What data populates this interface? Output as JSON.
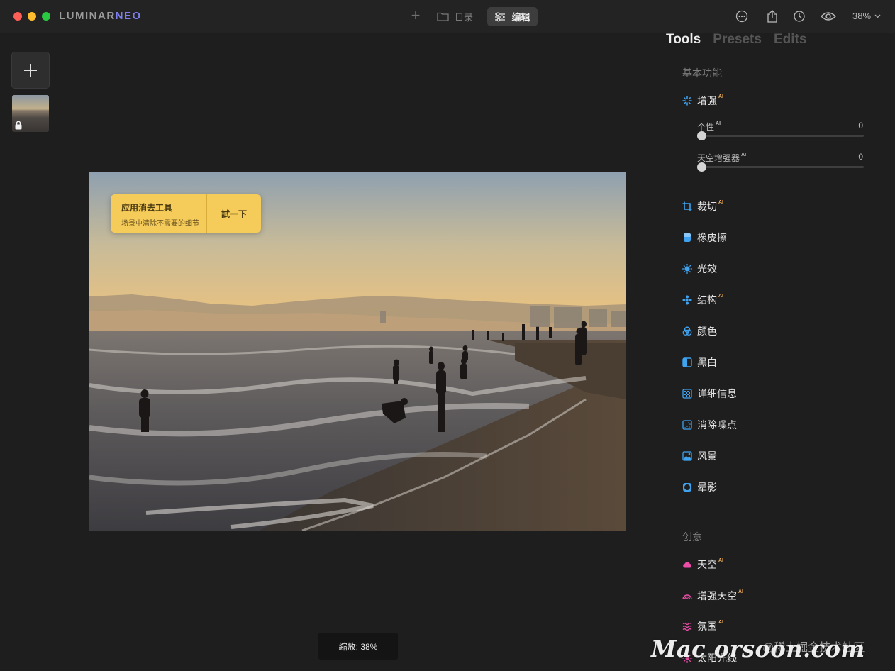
{
  "app": {
    "brand_part1": "LUMINAR",
    "brand_part2": "NEO"
  },
  "toolbar": {
    "add_icon": "plus-icon",
    "catalog_label": "目录",
    "edit_label": "编辑",
    "zoom_label": "38%",
    "right_icons": [
      "more-icon",
      "share-icon",
      "history-icon",
      "eye-icon"
    ]
  },
  "hint": {
    "title": "应用消去工具",
    "subtitle": "场景中清除不需要的细节",
    "button_label": "試一下"
  },
  "zoom_status": "縮放: 38%",
  "tabs": [
    {
      "label": "Tools",
      "active": true
    },
    {
      "label": "Presets",
      "active": false
    },
    {
      "label": "Edits",
      "active": false
    }
  ],
  "sections": {
    "basic": "基本功能",
    "creative": "创意"
  },
  "enhance": {
    "label": "增强",
    "ai": "AI",
    "sliders": [
      {
        "label": "个性",
        "ai": "AI",
        "value": "0"
      },
      {
        "label": "天空增强器",
        "ai": "AI",
        "value": "0"
      }
    ]
  },
  "tools": [
    {
      "label": "裁切",
      "ai": "AI",
      "icon": "crop-icon",
      "color": "#3fa3f0"
    },
    {
      "label": "橡皮擦",
      "ai": "",
      "icon": "eraser-icon",
      "color": "#3fa3f0"
    },
    {
      "label": "光效",
      "ai": "",
      "icon": "sun-icon",
      "color": "#3fa3f0"
    },
    {
      "label": "结构",
      "ai": "AI",
      "icon": "structure-icon",
      "color": "#3fa3f0"
    },
    {
      "label": "颜色",
      "ai": "",
      "icon": "color-icon",
      "color": "#3fa3f0"
    },
    {
      "label": "黑白",
      "ai": "",
      "icon": "bw-icon",
      "color": "#3fa3f0"
    },
    {
      "label": "详细信息",
      "ai": "",
      "icon": "details-icon",
      "color": "#3fa3f0"
    },
    {
      "label": "消除噪点",
      "ai": "",
      "icon": "denoise-icon",
      "color": "#3fa3f0"
    },
    {
      "label": "风景",
      "ai": "",
      "icon": "landscape-icon",
      "color": "#3fa3f0"
    },
    {
      "label": "晕影",
      "ai": "",
      "icon": "vignette-icon",
      "color": "#3fa3f0"
    }
  ],
  "creative_tools": [
    {
      "label": "天空",
      "ai": "AI",
      "icon": "cloud-icon",
      "color": "#ea4ea8"
    },
    {
      "label": "增强天空",
      "ai": "AI",
      "icon": "rainbow-icon",
      "color": "#ea4ea8"
    },
    {
      "label": "氛围",
      "ai": "AI",
      "icon": "waves-icon",
      "color": "#ea4ea8"
    },
    {
      "label": "太阳光线",
      "ai": "",
      "icon": "sunrays-icon",
      "color": "#ea4ea8"
    }
  ],
  "watermark": "Mac orsoon.com",
  "juejin": "@稀土掘金技术社区"
}
